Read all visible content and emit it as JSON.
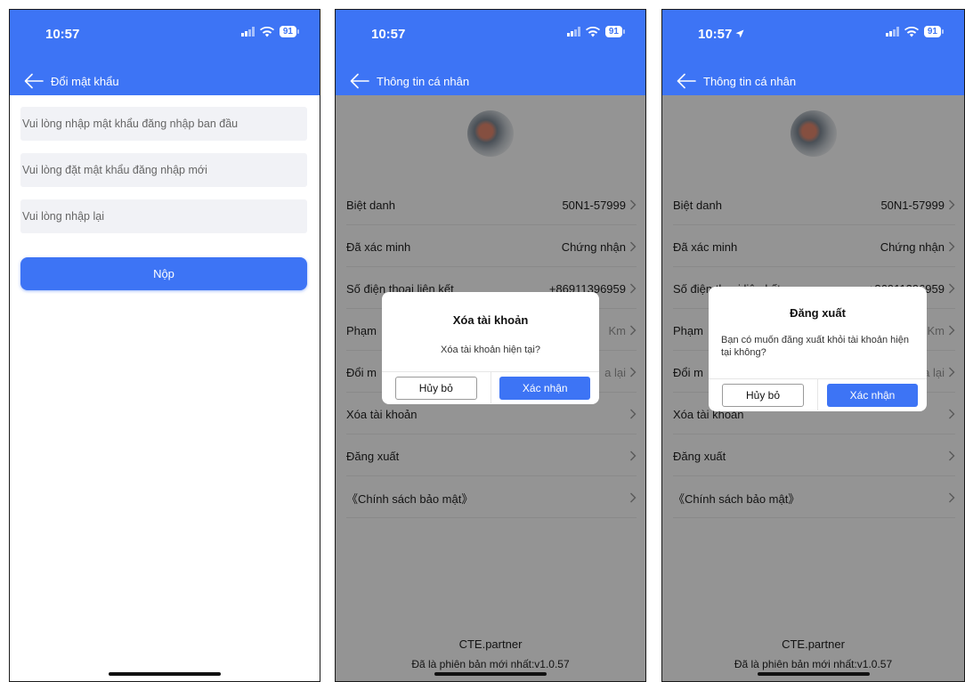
{
  "status": {
    "time": "10:57",
    "battery": "91"
  },
  "colors": {
    "primary": "#3d74f5",
    "input_bg": "#f1f2f6",
    "overlay": "rgba(0,0,0,0.42)"
  },
  "change_password": {
    "title": "Đổi mật khẩu",
    "fields": [
      {
        "placeholder": "Vui lòng nhập mật khẩu đăng nhập ban đầu"
      },
      {
        "placeholder": "Vui lòng đặt mật khẩu đăng nhập mới"
      },
      {
        "placeholder": "Vui lòng nhập lại"
      }
    ],
    "submit_label": "Nộp"
  },
  "profile": {
    "title": "Thông tin cá nhân",
    "rows": [
      {
        "label": "Biệt danh",
        "value": "50N1-57999"
      },
      {
        "label": "Đã xác minh",
        "value": "Chứng nhận"
      },
      {
        "label": "Số điện thoại liên kết",
        "value": "+86911396959"
      },
      {
        "label": "Phạm",
        "value": "Km"
      },
      {
        "label": "Đổi m",
        "value": "a lại"
      },
      {
        "label": "Xóa tài khoản",
        "value": ""
      },
      {
        "label": "Đăng xuất",
        "value": ""
      },
      {
        "label": "《Chính sách bảo mật》",
        "value": ""
      }
    ],
    "rows_full": [
      {
        "label": "Biệt danh",
        "value": "50N1-57999"
      },
      {
        "label": "Đã xác minh",
        "value": "Chứng nhận"
      },
      {
        "label": "Số điện thoại liên kết",
        "value": "+86911396959"
      },
      {
        "label": "Phạm",
        "value": "Km"
      },
      {
        "label": "Đổi m",
        "value": "a lại"
      },
      {
        "label": "Xóa tài khoản",
        "value": ""
      },
      {
        "label": "Đăng xuất",
        "value": ""
      },
      {
        "label": "《Chính sách bảo mật》",
        "value": ""
      }
    ],
    "footer_brand": "CTE.partner",
    "footer_version": "Đã là phiên bản mới nhất:v1.0.57"
  },
  "dialog_delete": {
    "title": "Xóa tài khoản",
    "message": "Xóa tài khoản hiện tại?",
    "cancel": "Hủy bỏ",
    "confirm": "Xác nhận"
  },
  "dialog_logout": {
    "title": "Đăng xuất",
    "message": "Bạn có muốn đăng xuất khỏi tài khoản hiện tại không?",
    "cancel": "Hủy bỏ",
    "confirm": "Xác nhận"
  }
}
